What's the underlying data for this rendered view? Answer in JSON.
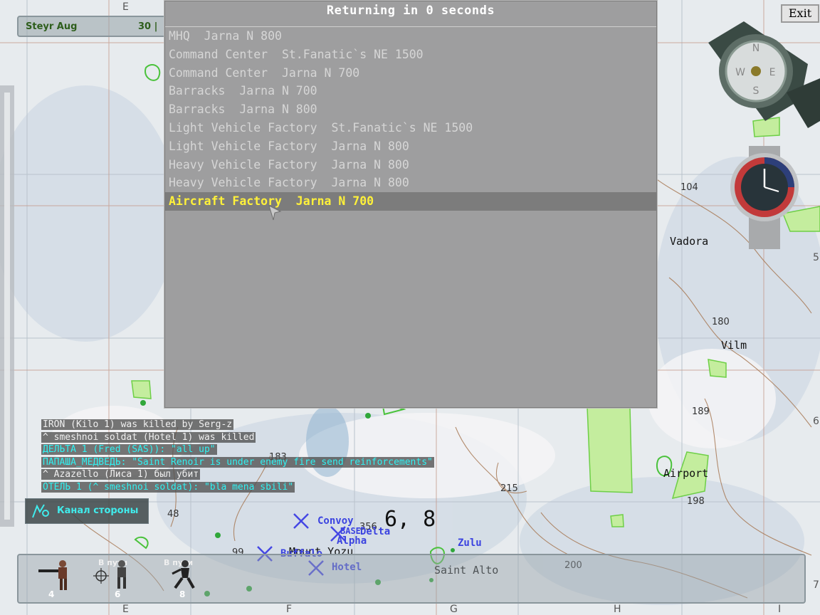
{
  "weapon": {
    "name": "Steyr Aug",
    "ammo": "30 |"
  },
  "exit_label": "Exit",
  "dialog": {
    "title": "Returning in 0 seconds",
    "items": [
      "MHQ  Jarna N 800",
      "Command Center  St.Fanatic`s NE 1500",
      "Command Center  Jarna N 700",
      "Barracks  Jarna N 700",
      "Barracks  Jarna N 800",
      "Light Vehicle Factory  St.Fanatic`s NE 1500",
      "Light Vehicle Factory  Jarna N 800",
      "Heavy Vehicle Factory  Jarna N 800",
      "Heavy Vehicle Factory  Jarna N 800",
      "Aircraft Factory  Jarna N 700"
    ],
    "selected_index": 9
  },
  "chat": [
    {
      "text": "IRON (Kilo 1) was killed by Serg-z",
      "color": "white"
    },
    {
      "text": "^ smeshnoi soldat (Hotel 1) was killed",
      "color": "white"
    },
    {
      "text": "ДЕЛЬТА 1 (Fred (SAS)): \"all up\"",
      "color": "cyan"
    },
    {
      "text": "ПАПАША_МЕДВЕДЬ: \"Saint Renoir is under enemy fire send reinforcements\"",
      "color": "cyan"
    },
    {
      "text": "^ Azazello (Лиса 1) был убит",
      "color": "white"
    },
    {
      "text": "ОТЕЛЬ 1 (^ smeshnoi soldat): \"bla mena sbili\"",
      "color": "cyan"
    }
  ],
  "channel_label": "Канал стороны",
  "units": [
    {
      "num": "4",
      "tag": ""
    },
    {
      "num": "6",
      "tag": "В пути"
    },
    {
      "num": "8",
      "tag": "В пути"
    }
  ],
  "grid_letters_top": [
    "E"
  ],
  "grid_letters_bottom": [
    "E",
    "F",
    "G",
    "H",
    "I"
  ],
  "grid_numbers_right": [
    "5",
    "6",
    "7"
  ],
  "heights": [
    "104",
    "180",
    "189",
    "198",
    "215",
    "200",
    "183",
    "356",
    "99",
    "48"
  ],
  "places": [
    "Vadora",
    "Vilm",
    "Airport",
    "Saint Alto",
    "Mount Yozu"
  ],
  "groups": [
    "Convoy",
    "Delta",
    "Alpha",
    "Buffalo",
    "Hotel",
    "Zulu",
    "BASE"
  ],
  "grid_readout": "6, 8",
  "icons": {
    "compass": "compass-icon",
    "watch": "watch-icon",
    "cursor": "arrow-cursor-icon"
  }
}
